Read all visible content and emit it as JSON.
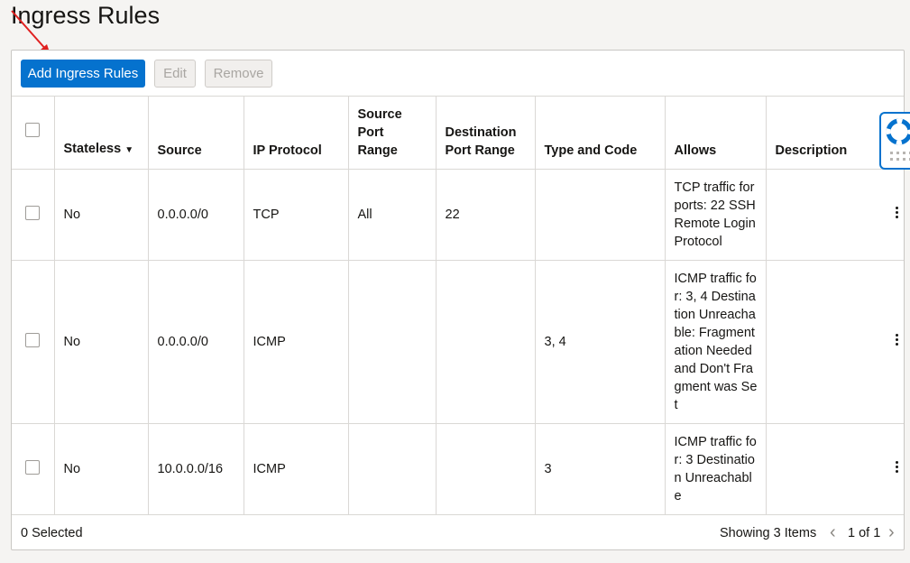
{
  "page": {
    "title": "Ingress Rules"
  },
  "toolbar": {
    "add_label": "Add Ingress Rules",
    "edit_label": "Edit",
    "remove_label": "Remove"
  },
  "table": {
    "headers": {
      "stateless": "Stateless",
      "source": "Source",
      "ip_protocol": "IP Protocol",
      "source_port_range": "Source Port Range",
      "destination_port_range": "Destination Port Range",
      "type_and_code": "Type and Code",
      "allows": "Allows",
      "description": "Description"
    },
    "rows": [
      {
        "stateless": "No",
        "source": "0.0.0.0/0",
        "ip_protocol": "TCP",
        "source_port_range": "All",
        "destination_port_range": "22",
        "type_and_code": "",
        "allows": "TCP traffic for ports: 22 SSH Remote Login Protocol",
        "description": ""
      },
      {
        "stateless": "No",
        "source": "0.0.0.0/0",
        "ip_protocol": "ICMP",
        "source_port_range": "",
        "destination_port_range": "",
        "type_and_code": "3, 4",
        "allows": "ICMP traffic for: 3, 4 Destination Unreachable: Fragmentation Needed and Don't Fragment was Set",
        "description": ""
      },
      {
        "stateless": "No",
        "source": "10.0.0.0/16",
        "ip_protocol": "ICMP",
        "source_port_range": "",
        "destination_port_range": "",
        "type_and_code": "3",
        "allows": "ICMP traffic for: 3 Destination Unreachable",
        "description": ""
      }
    ]
  },
  "footer": {
    "selected": "0 Selected",
    "showing": "Showing 3 Items",
    "page_of": "1 of 1"
  },
  "icons": {
    "sort": "sort-descending-icon",
    "prev": "chevron-left-icon",
    "next": "chevron-right-icon",
    "help": "lifebuoy-icon",
    "row_actions": "kebab-menu-icon"
  },
  "colors": {
    "primary": "#0572ce",
    "annotation_arrow": "#e02020"
  }
}
